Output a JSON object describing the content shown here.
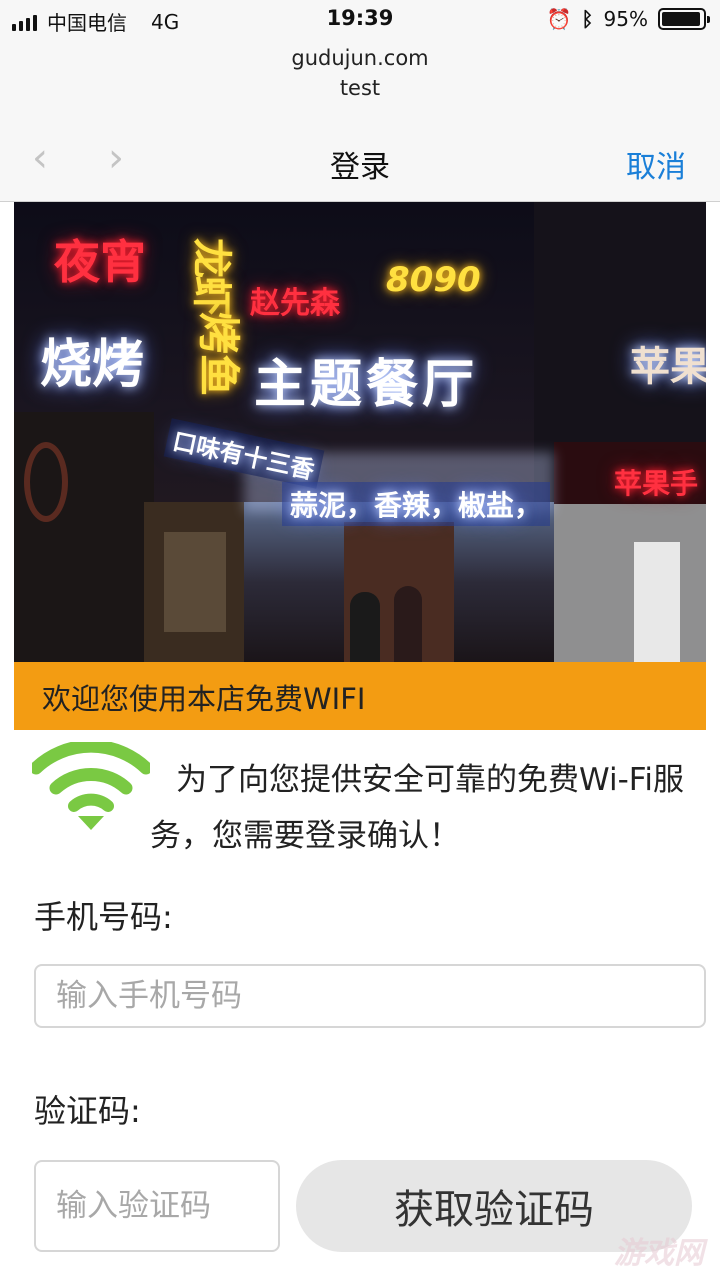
{
  "status_bar": {
    "carrier": "中国电信",
    "network": "4G",
    "time": "19:39",
    "battery": "95%",
    "battery_level": 0.95
  },
  "browser": {
    "domain": "gudujun.com",
    "page_title": "test"
  },
  "nav": {
    "title": "登录",
    "cancel_label": "取消",
    "back_icon": "chevron-left-icon",
    "forward_icon": "chevron-right-icon"
  },
  "hero": {
    "sign_line1_red": "夜宵",
    "sign_line1_yellow": "龙虾",
    "sign_red_small": "赵先森",
    "sign_numbers": "8090",
    "sign_bbq": "烧烤",
    "sign_fish": "烤鱼",
    "sign_main": "主题餐厅",
    "sign_apple": "苹果",
    "sign_apple_shop": "苹果手",
    "sign_flavor": "口味有十三香",
    "sign_flavors": "蒜泥，香辣，椒盐，"
  },
  "banner": {
    "text": "欢迎您使用本店免费WIFI"
  },
  "info": {
    "icon": "wifi-icon",
    "text": "为了向您提供安全可靠的免费Wi-Fi服务，您需要登录确认！"
  },
  "form": {
    "phone_label": "手机号码:",
    "phone_placeholder": "输入手机号码",
    "code_label": "验证码:",
    "code_placeholder": "输入验证码",
    "get_code_label": "获取验证码"
  },
  "watermark": "游戏网",
  "colors": {
    "banner": "#f39c12",
    "accent": "#1a7fd8",
    "wifi": "#7ac943"
  }
}
